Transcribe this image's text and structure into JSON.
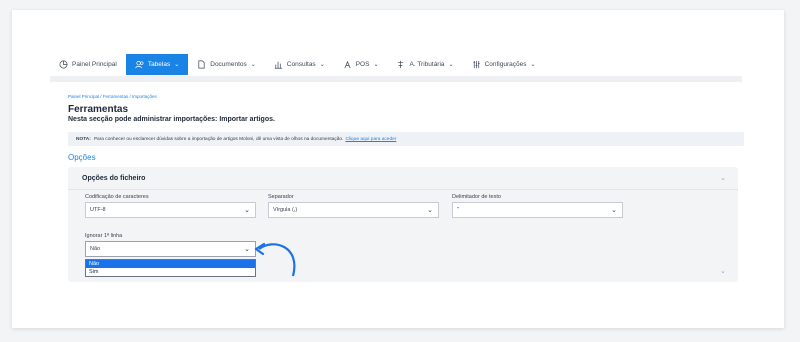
{
  "nav": {
    "items": [
      {
        "label": "Painel Principal",
        "icon": "pie-chart-icon",
        "active": false,
        "chevron": false
      },
      {
        "label": "Tabelas",
        "icon": "users-icon",
        "active": true,
        "chevron": true
      },
      {
        "label": "Documentos",
        "icon": "document-icon",
        "active": false,
        "chevron": true
      },
      {
        "label": "Consultas",
        "icon": "bar-chart-icon",
        "active": false,
        "chevron": true
      },
      {
        "label": "POS",
        "icon": "pos-icon",
        "active": false,
        "chevron": true
      },
      {
        "label": "A. Tributária",
        "icon": "tax-icon",
        "active": false,
        "chevron": true
      },
      {
        "label": "Configurações",
        "icon": "sliders-icon",
        "active": false,
        "chevron": true
      }
    ]
  },
  "breadcrumb": "Painel Principal  /  Ferramentas  /  Importações",
  "page": {
    "title": "Ferramentas",
    "subtitle": "Nesta secção pode administrar importações: Importar artigos."
  },
  "note": {
    "prefix": "NOTA:",
    "text": "Para conhecer ou esclarecer dúvidas sobre a importação de artigos Moloni, dê uma vista de olhos na documentação.",
    "link": "Clique aqui para aceder"
  },
  "section_title": "Opções",
  "panel": {
    "title": "Opções do ficheiro",
    "encoding": {
      "label": "Codificação de caracteres",
      "value": "UTF-8"
    },
    "separator": {
      "label": "Separador",
      "value": "Vírgula (,)"
    },
    "delimiter": {
      "label": "Delimitador de texto",
      "value": "\""
    },
    "ignore_first": {
      "label": "Ignorar 1ª linha",
      "value": "Não",
      "options": [
        "Não",
        "Sim"
      ]
    }
  },
  "colors": {
    "accent": "#1a84e6",
    "selection": "#1a73e8"
  }
}
